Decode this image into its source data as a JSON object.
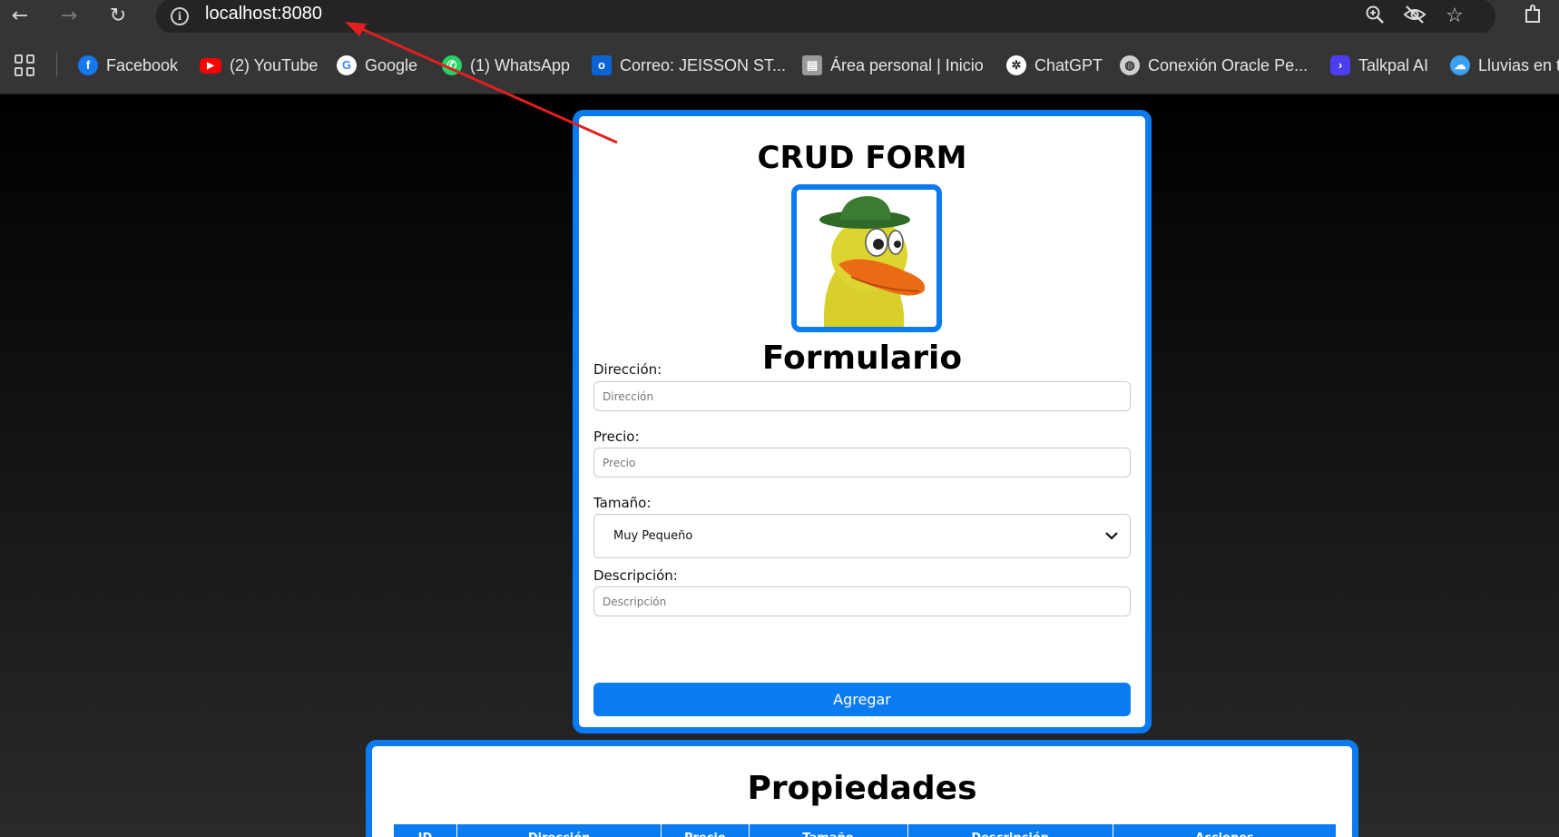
{
  "browser": {
    "url": "localhost:8080",
    "bookmarks": [
      {
        "label": "Facebook",
        "icon": "facebook-icon",
        "color": "#1877f2"
      },
      {
        "label": "(2) YouTube",
        "icon": "youtube-icon",
        "color": "#ff0000"
      },
      {
        "label": "Google",
        "icon": "google-icon",
        "color": "#4285f4"
      },
      {
        "label": "(1) WhatsApp",
        "icon": "whatsapp-icon",
        "color": "#25d366"
      },
      {
        "label": "Correo: JEISSON ST...",
        "icon": "outlook-icon",
        "color": "#0a64d6"
      },
      {
        "label": "Área personal | Inicio",
        "icon": "moodle-icon",
        "color": "#9a9a9a"
      },
      {
        "label": "ChatGPT",
        "icon": "chatgpt-icon",
        "color": "#ffffff"
      },
      {
        "label": "Conexión Oracle Pe...",
        "icon": "globe-icon",
        "color": "#cfcfcf"
      },
      {
        "label": "Talkpal AI",
        "icon": "talkpal-icon",
        "color": "#4b3df0"
      },
      {
        "label": "Lluvias en t",
        "icon": "weather-icon",
        "color": "#3aa0f0"
      }
    ]
  },
  "form": {
    "title": "CRUD FORM",
    "heading": "Formulario",
    "direccion_label": "Dirección:",
    "direccion_placeholder": "Dirección",
    "precio_label": "Precio:",
    "precio_placeholder": "Precio",
    "tamano_label": "Tamaño:",
    "tamano_value": "Muy Pequeño",
    "descripcion_label": "Descripción:",
    "descripcion_placeholder": "Descripción",
    "submit_label": "Agregar"
  },
  "table": {
    "title": "Propiedades",
    "columns": [
      "ID",
      "Dirección",
      "Precio",
      "Tamaño",
      "Descripción",
      "Acciones"
    ]
  },
  "colors": {
    "accent": "#0b7bf2",
    "annotation_arrow": "#e02020"
  }
}
